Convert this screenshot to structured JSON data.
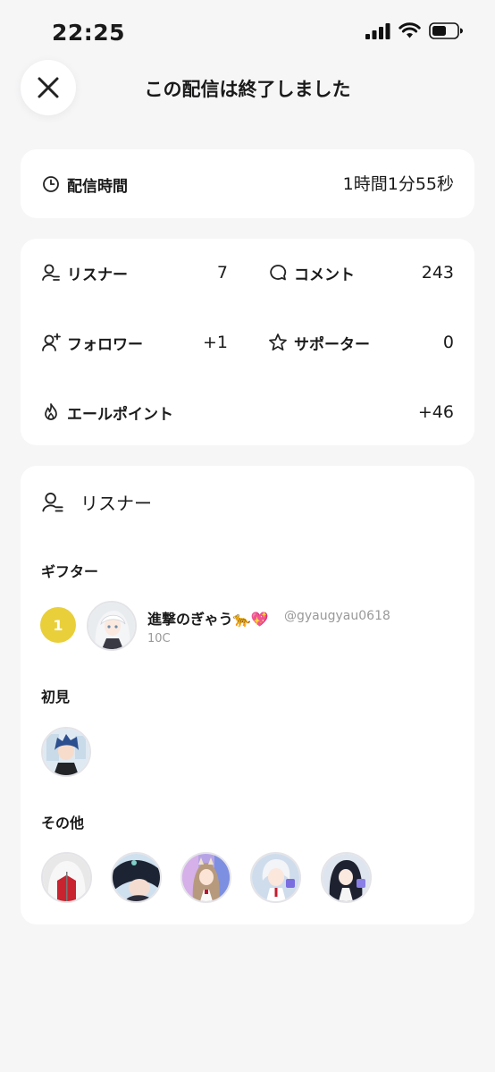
{
  "status_bar": {
    "time": "22:25"
  },
  "header": {
    "title": "この配信は終了しました"
  },
  "duration": {
    "label": "配信時間",
    "value": "1時間1分55秒"
  },
  "stats": {
    "listeners": {
      "label": "リスナー",
      "value": "7"
    },
    "comments": {
      "label": "コメント",
      "value": "243"
    },
    "followers": {
      "label": "フォロワー",
      "value": "+1"
    },
    "supporters": {
      "label": "サポーター",
      "value": "0"
    },
    "yell_points": {
      "label": "エールポイント",
      "value": "+46"
    }
  },
  "listeners_section": {
    "title": "リスナー",
    "gifter_heading": "ギフター",
    "gifter": {
      "rank": "1",
      "name": "進撃のぎゃう🐆💖",
      "handle": "@gyaugyau0618",
      "coins": "10C"
    },
    "first_time_heading": "初見",
    "others_heading": "その他"
  },
  "colors": {
    "background": "#f6f6f7",
    "card": "#ffffff",
    "rank_badge": "#e9cf3a"
  }
}
